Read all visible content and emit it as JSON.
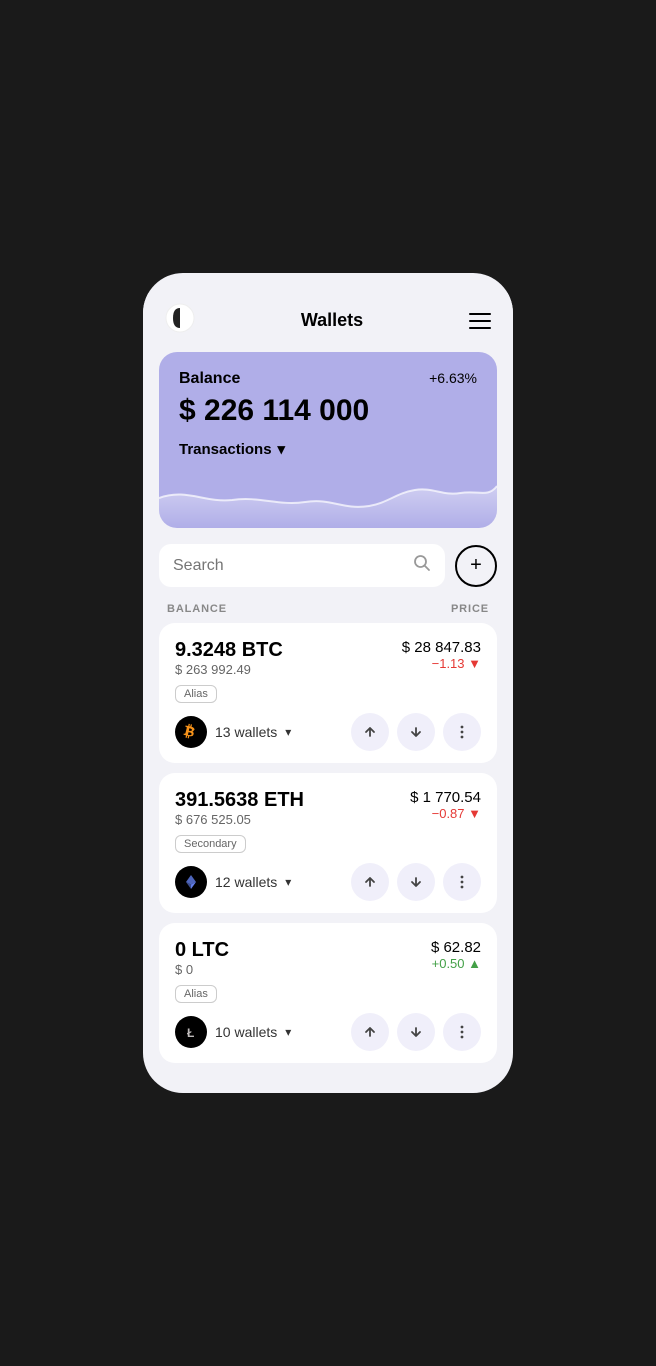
{
  "header": {
    "title": "Wallets",
    "hamburger_label": "Menu"
  },
  "balance_card": {
    "label": "Balance",
    "percent": "+6.63%",
    "amount": "$ 226 114 000",
    "transactions_label": "Transactions"
  },
  "search": {
    "placeholder": "Search",
    "add_btn_label": "+"
  },
  "table_headers": {
    "balance": "BALANCE",
    "price": "PRICE"
  },
  "coins": [
    {
      "amount": "9.3248 BTC",
      "usd_value": "$ 263 992.49",
      "price": "$ 28 847.83",
      "change": "−1.13 ▼",
      "change_type": "negative",
      "tag": "Alias",
      "wallets_count": "13 wallets",
      "logo_char": "₿",
      "logo_type": "btc"
    },
    {
      "amount": "391.5638 ETH",
      "usd_value": "$ 676 525.05",
      "price": "$ 1 770.54",
      "change": "−0.87 ▼",
      "change_type": "negative",
      "tag": "Secondary",
      "wallets_count": "12 wallets",
      "logo_char": "⬡",
      "logo_type": "eth"
    },
    {
      "amount": "0 LTC",
      "usd_value": "$ 0",
      "price": "$ 62.82",
      "change": "+0.50 ▲",
      "change_type": "positive",
      "tag": "Alias",
      "wallets_count": "10 wallets",
      "logo_char": "Ł",
      "logo_type": "ltc"
    }
  ],
  "icons": {
    "send": "↑",
    "receive": "↓",
    "more": "⋮",
    "search": "🔍",
    "add": "+",
    "chevron_down": "▾"
  }
}
